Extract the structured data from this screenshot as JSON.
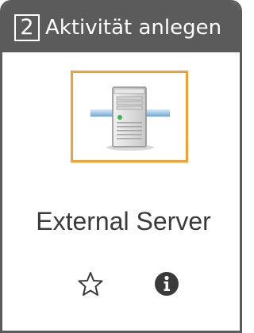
{
  "header": {
    "step_number": "2",
    "title": "Aktivität anlegen"
  },
  "service": {
    "name": "External Server",
    "icon": "server-icon"
  },
  "actions": {
    "favorite_icon": "star-outline-icon",
    "info_icon": "info-circle-icon"
  },
  "colors": {
    "header_background": "#5b5b5b",
    "selection_border": "#f5a033",
    "text": "#3a3a3a"
  }
}
